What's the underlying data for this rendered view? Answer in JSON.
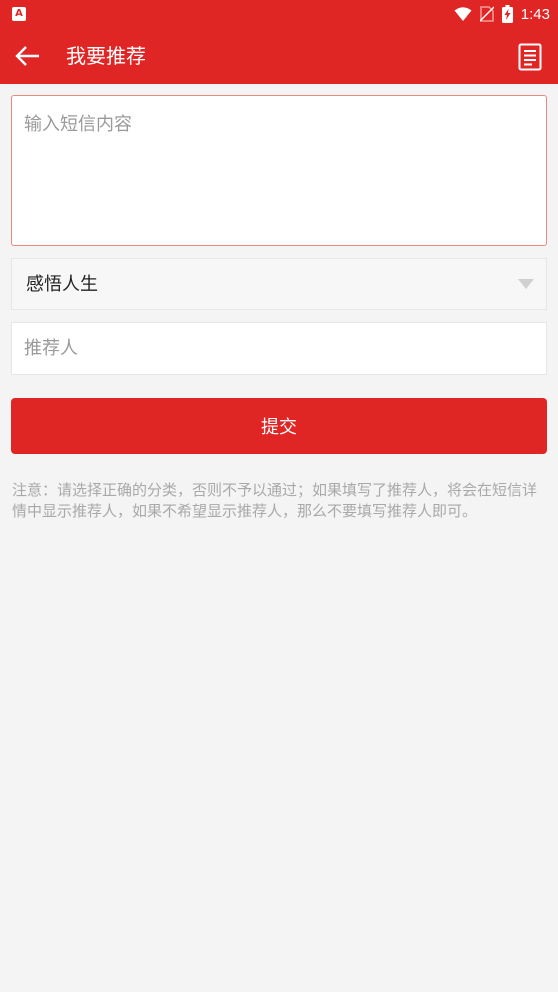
{
  "status_bar": {
    "time": "1:43",
    "app_icon_letter": "A"
  },
  "toolbar": {
    "title": "我要推荐"
  },
  "form": {
    "sms_placeholder": "输入短信内容",
    "category_selected": "感悟人生",
    "recommender_placeholder": "推荐人",
    "submit_label": "提交"
  },
  "notice": "注意：请选择正确的分类，否则不予以通过；如果填写了推荐人，将会在短信详情中显示推荐人，如果不希望显示推荐人，那么不要填写推荐人即可。",
  "colors": {
    "primary": "#e02525",
    "background": "#f4f4f4",
    "hint_text": "#a9a9a9"
  },
  "icons": [
    "android-app-icon",
    "wifi-icon",
    "no-sim-icon",
    "battery-charging-icon",
    "back-arrow-icon",
    "document-icon",
    "dropdown-arrow-icon"
  ]
}
